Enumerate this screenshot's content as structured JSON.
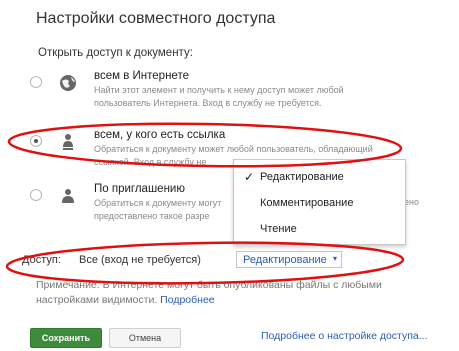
{
  "dialog": {
    "title": "Настройки совместного доступа",
    "open_access_label": "Открыть доступ к документу:"
  },
  "options": [
    {
      "title": "всем в Интернете",
      "desc_line1": "Найти этот элемент и получить к нему доступ может любой",
      "desc_line2": "пользователь Интернета. Вход в службу не требуется.",
      "icon": "globe-icon",
      "selected": false
    },
    {
      "title": "всем, у кого есть ссылка",
      "desc_line1": "Обратиться к документу может любой пользователь, обладающий",
      "desc_line2": "ссылкой. Вход в службу не",
      "icon": "link-person-icon",
      "selected": true
    },
    {
      "title": "По приглашению",
      "desc_line1": "Обратиться к документу могут",
      "desc_line2": "предоставлено такое разре",
      "desc_tail": "ено",
      "icon": "person-icon",
      "selected": false
    }
  ],
  "access": {
    "label": "Доступ:",
    "value": "Все (вход не требуется)",
    "dropdown_value": "Редактирование",
    "caret": "▾"
  },
  "permission_menu": {
    "items": [
      {
        "label": "Редактирование",
        "checked": true,
        "check": "✓"
      },
      {
        "label": "Комментирование",
        "checked": false
      },
      {
        "label": "Чтение",
        "checked": false
      }
    ]
  },
  "note": {
    "text_line1": "Примечание. В Интернете могут быть опубликованы файлы с любыми",
    "text_line2": "настройками видимости.",
    "link": "Подробнее"
  },
  "footer": {
    "save": "Сохранить",
    "cancel": "Отмена",
    "more_link": "Подробнее о настройке доступа..."
  },
  "colors": {
    "link": "#2a5db0",
    "save_button": "#3c8c3c",
    "annotation": "#e01010"
  }
}
